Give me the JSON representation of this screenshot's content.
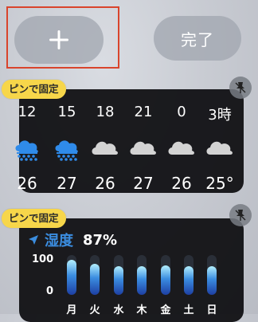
{
  "toolbar": {
    "add_label": "+",
    "done_label": "完了"
  },
  "pin_badge_label": "ピンで固定",
  "weather": {
    "hours": [
      {
        "hour": "12",
        "icon": "rain-cloud-icon",
        "temp": "26"
      },
      {
        "hour": "15",
        "icon": "rain-cloud-icon",
        "temp": "27"
      },
      {
        "hour": "18",
        "icon": "cloud-icon",
        "temp": "26"
      },
      {
        "hour": "21",
        "icon": "cloud-icon",
        "temp": "27"
      },
      {
        "hour": "0",
        "icon": "cloud-icon",
        "temp": "26"
      },
      {
        "hour": "3時",
        "icon": "cloud-icon",
        "temp": "25°"
      }
    ]
  },
  "humidity": {
    "label": "湿度",
    "value": "87%",
    "y_max": "100",
    "y_min": "0",
    "days": [
      {
        "day": "月",
        "value": 87
      },
      {
        "day": "火",
        "value": 78
      },
      {
        "day": "水",
        "value": 72
      },
      {
        "day": "木",
        "value": 72
      },
      {
        "day": "金",
        "value": 73
      },
      {
        "day": "土",
        "value": 72
      },
      {
        "day": "日",
        "value": 72
      }
    ]
  },
  "colors": {
    "badge": "#f7d64a",
    "widget_bg": "#0f0f12",
    "accent_blue": "#3b8de0",
    "highlight": "#d9442c"
  }
}
